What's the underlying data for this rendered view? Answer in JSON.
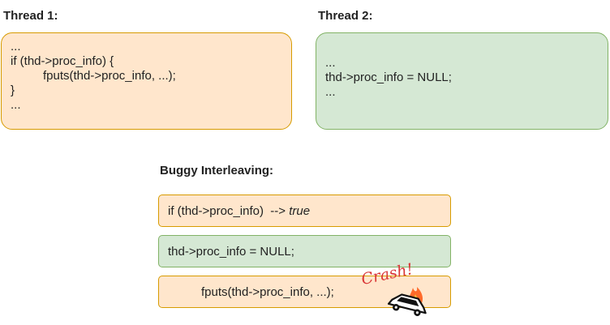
{
  "thread1": {
    "title": "Thread 1:",
    "lines": [
      "...",
      "if (thd->proc_info) {",
      "fputs(thd->proc_info, ...);",
      "}",
      "..."
    ]
  },
  "thread2": {
    "title": "Thread 2:",
    "lines": [
      "...",
      "thd->proc_info = NULL;",
      "..."
    ]
  },
  "interleaving": {
    "title": "Buggy Interleaving:",
    "step1": {
      "code": "if (thd->proc_info)  --> ",
      "result": "true"
    },
    "step2": {
      "code": "thd->proc_info = NULL;"
    },
    "step3": {
      "code": "fputs(thd->proc_info, ...);",
      "crash": "Crash!"
    }
  },
  "colors": {
    "thread1_fill": "#ffe6cc",
    "thread1_stroke": "#d79b00",
    "thread2_fill": "#d5e8d4",
    "thread2_stroke": "#82b366",
    "crash": "#d93636"
  },
  "icons": [
    "crashed-car-icon",
    "fire-icon"
  ]
}
